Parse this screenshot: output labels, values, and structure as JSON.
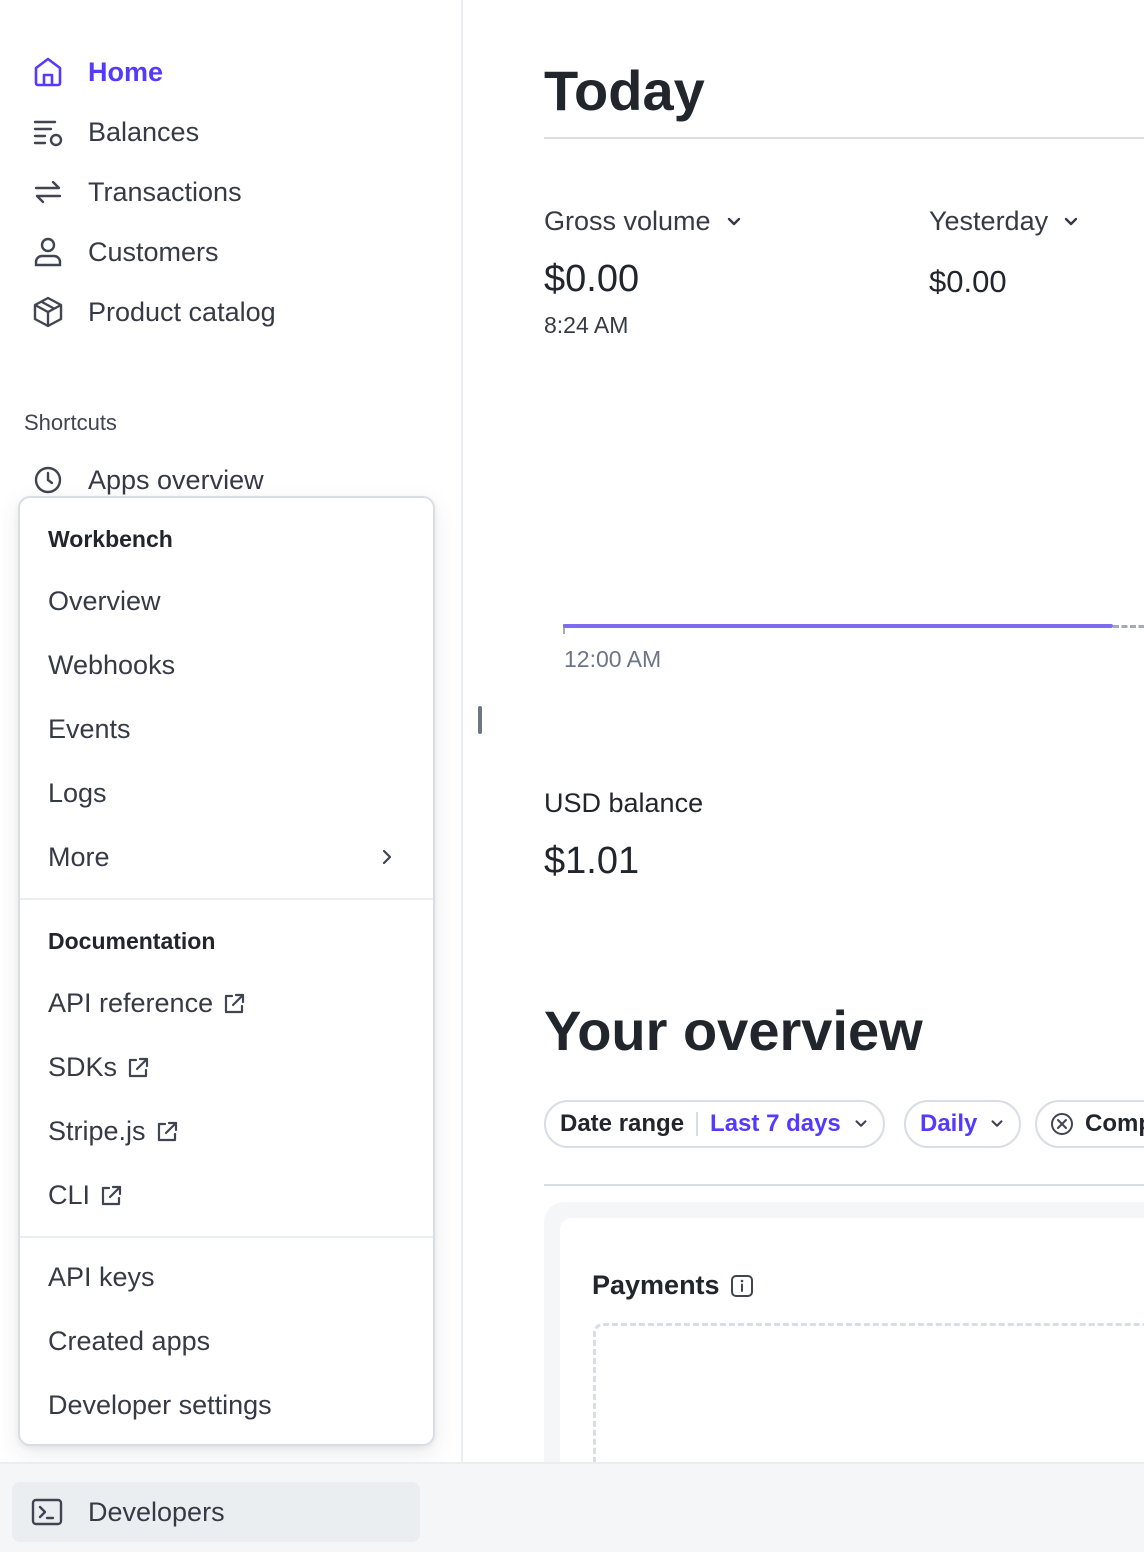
{
  "sidebar": {
    "nav": [
      {
        "label": "Home",
        "icon": "home-icon",
        "active": true
      },
      {
        "label": "Balances",
        "icon": "balances-icon"
      },
      {
        "label": "Transactions",
        "icon": "transactions-icon"
      },
      {
        "label": "Customers",
        "icon": "person-icon"
      },
      {
        "label": "Product catalog",
        "icon": "box-icon"
      }
    ],
    "shortcuts_title": "Shortcuts",
    "shortcuts": [
      {
        "label": "Apps overview",
        "icon": "clock-icon"
      }
    ]
  },
  "dev_menu": {
    "workbench_header": "Workbench",
    "workbench_items": [
      "Overview",
      "Webhooks",
      "Events",
      "Logs",
      "More"
    ],
    "docs_header": "Documentation",
    "docs_items": [
      "API reference",
      "SDKs",
      "Stripe.js",
      "CLI"
    ],
    "other_items": [
      "API keys",
      "Created apps",
      "Developer settings"
    ]
  },
  "bottom": {
    "developers_label": "Developers",
    "icon": "terminal-icon"
  },
  "main": {
    "today_title": "Today",
    "gross_volume_label": "Gross volume",
    "gross_volume_value": "$0.00",
    "gross_volume_time": "8:24 AM",
    "compare_label": "Yesterday",
    "compare_value": "$0.00",
    "chart_start_time": "12:00 AM",
    "usd_balance_label": "USD balance",
    "usd_balance_value": "$1.01",
    "overview_title": "Your overview",
    "filters": {
      "date_range_label": "Date range",
      "date_range_value": "Last 7 days",
      "interval_value": "Daily",
      "compare_chip_label": "Comp"
    },
    "payments_card_title": "Payments"
  },
  "colors": {
    "accent": "#533afd",
    "chart_line": "#7d6bf2",
    "text_primary": "#21252c",
    "text_secondary": "#353a44"
  }
}
